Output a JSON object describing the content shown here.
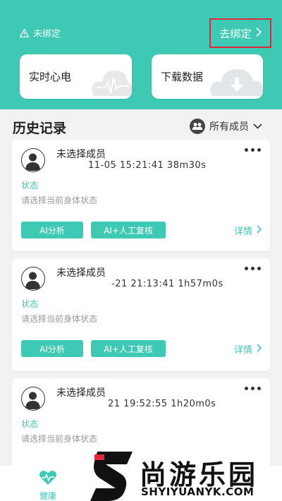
{
  "header": {
    "bind_status": "未绑定",
    "bind_link": "去绑定"
  },
  "features": [
    {
      "label": "实时心电",
      "icon": "ecg-cloud-icon"
    },
    {
      "label": "下载数据",
      "icon": "download-cloud-icon"
    }
  ],
  "history": {
    "title": "历史记录",
    "filter_label": "所有成员"
  },
  "records": [
    {
      "member": "未选择成员",
      "time": "11-05 15:21:41  38m30s",
      "status_label": "状态",
      "status_placeholder": "请选择当前身体状态",
      "btn_ai": "AI分析",
      "btn_ai_plus": "AI+人工复核",
      "details": "详情"
    },
    {
      "member": "未选择成员",
      "time": "-21 21:13:41  1h57m0s",
      "status_label": "状态",
      "status_placeholder": "请选择当前身体状态",
      "btn_ai": "AI分析",
      "btn_ai_plus": "AI+人工复核",
      "details": "详情"
    },
    {
      "member": "未选择成员",
      "time": "21 19:52:55  1h20m0s",
      "status_label": "状态",
      "status_placeholder": "请选择当前身体状态"
    }
  ],
  "nav": {
    "health_label": "健康"
  },
  "watermark": {
    "cn": "尚游乐园",
    "en": "SHYIYUANYK.COM"
  },
  "colors": {
    "accent": "#3ec9b4",
    "highlight_border": "#e0283a"
  }
}
